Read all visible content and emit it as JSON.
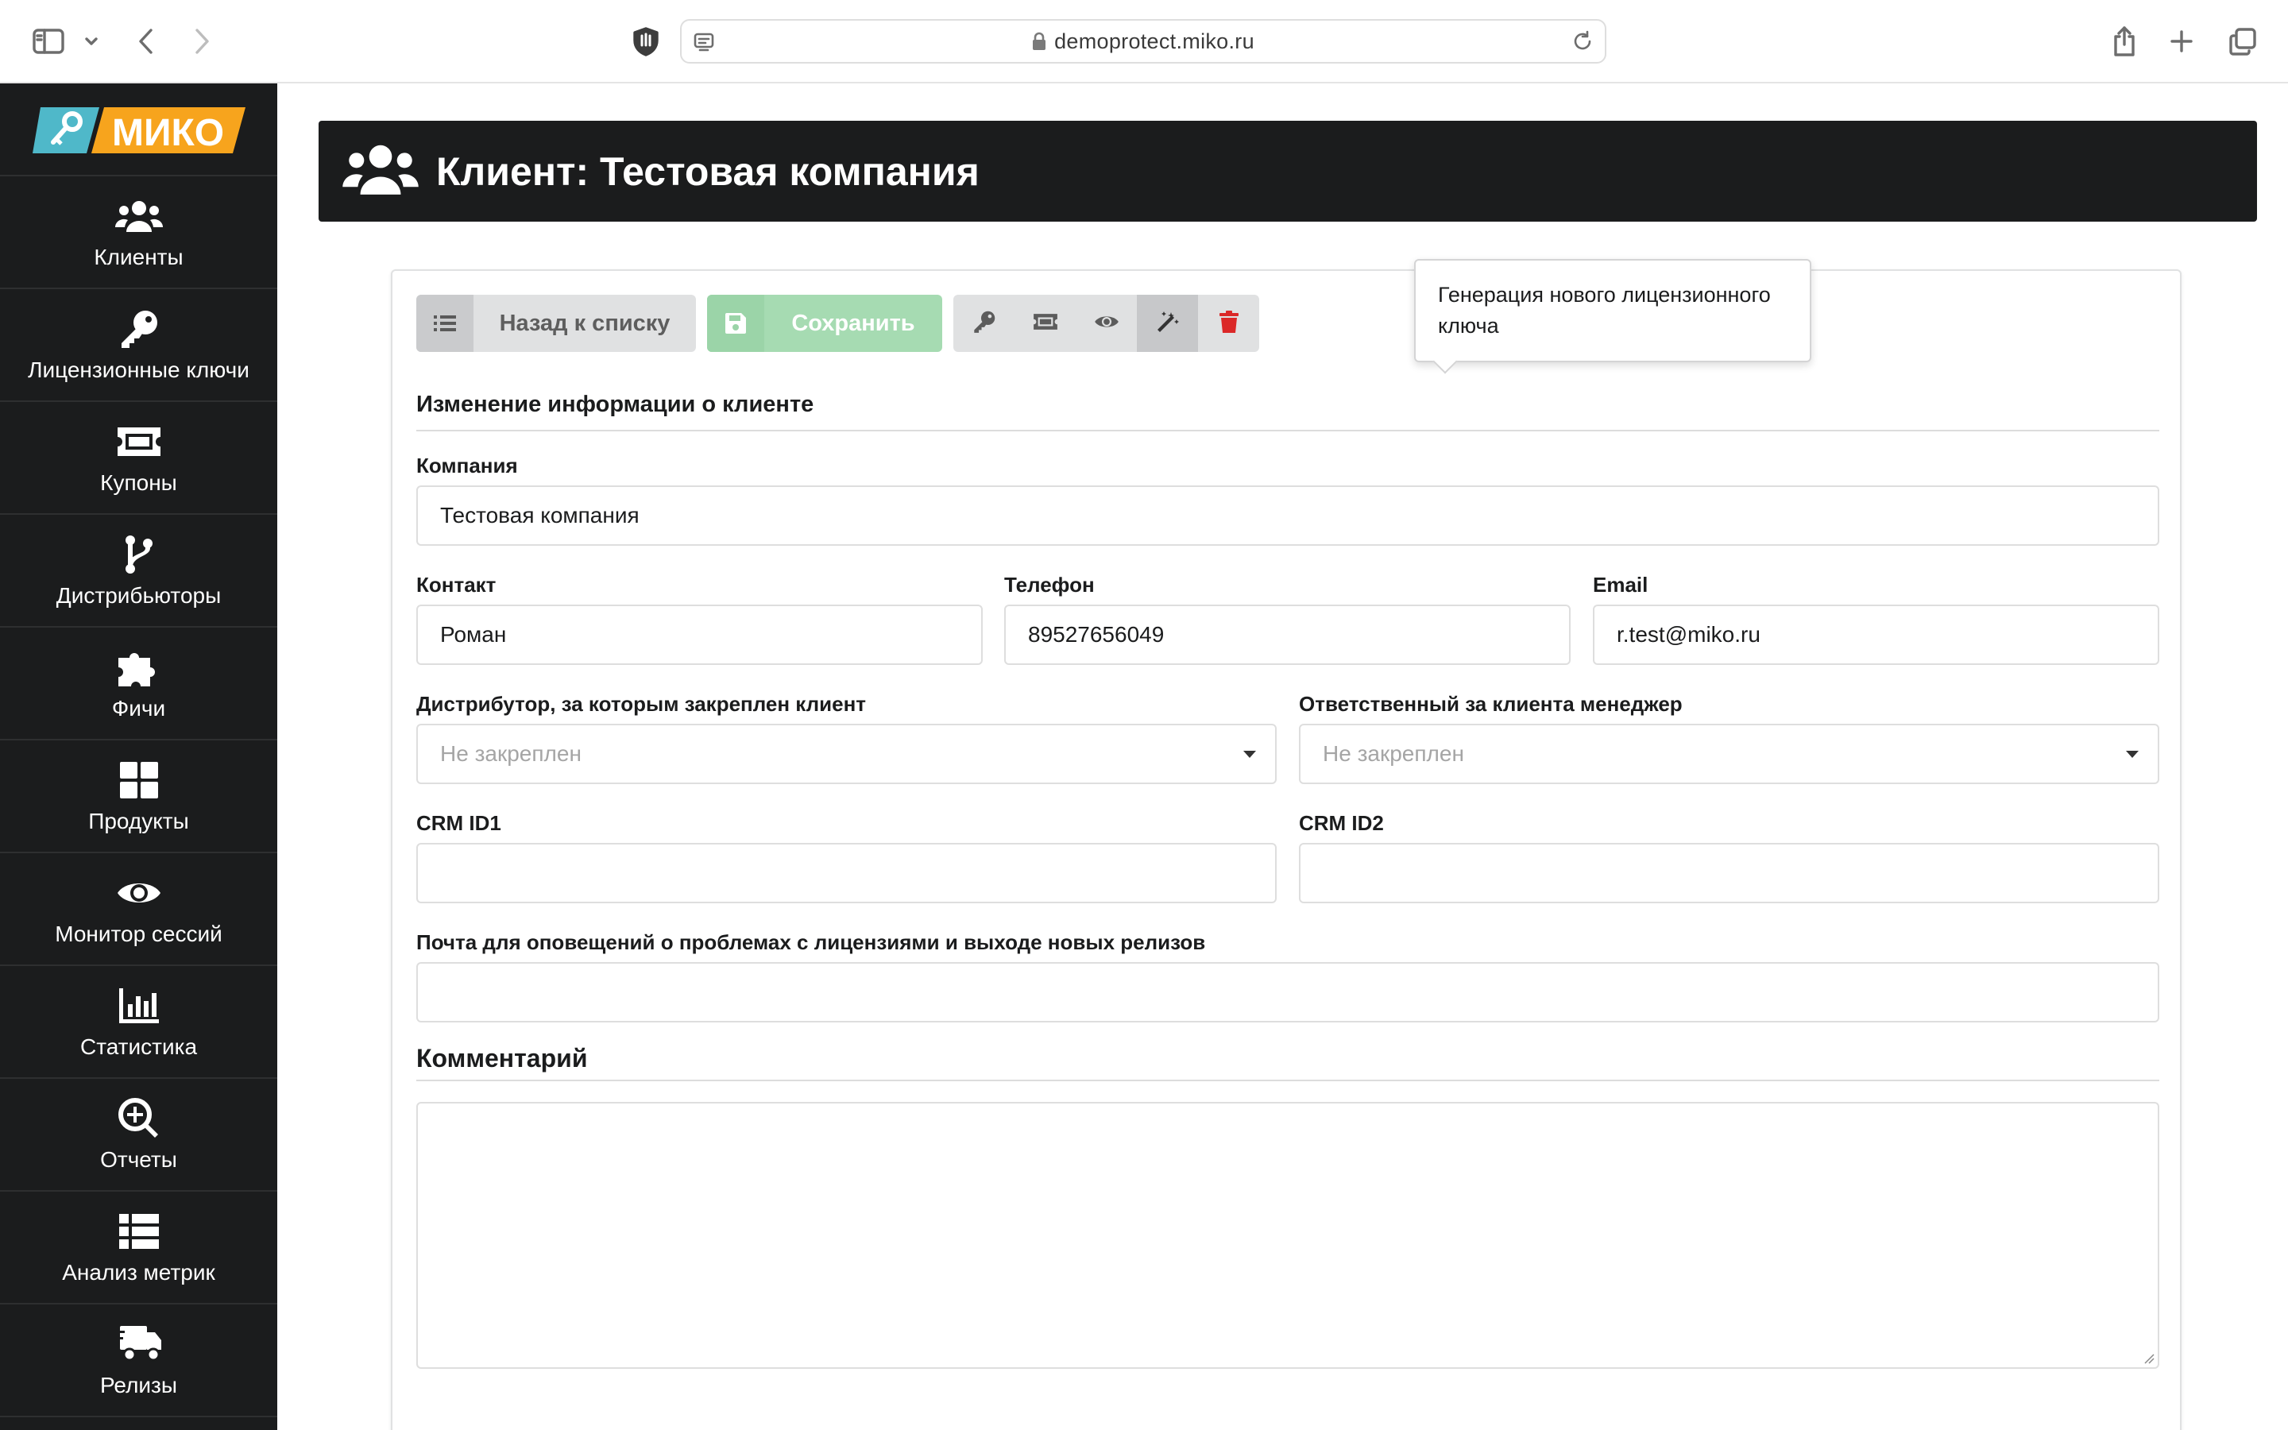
{
  "browser": {
    "url": "demoprotect.miko.ru"
  },
  "brand": {
    "logo_text": "МИКО",
    "accent_orange": "#f7a41d",
    "accent_teal": "#4fb8c9"
  },
  "sidebar": {
    "items": [
      {
        "label": "Клиенты",
        "icon": "users-icon"
      },
      {
        "label": "Лицензионные ключи",
        "icon": "key-icon"
      },
      {
        "label": "Купоны",
        "icon": "ticket-icon"
      },
      {
        "label": "Дистрибьюторы",
        "icon": "code-branch-icon"
      },
      {
        "label": "Фичи",
        "icon": "puzzle-icon"
      },
      {
        "label": "Продукты",
        "icon": "grid-icon"
      },
      {
        "label": "Монитор сессий",
        "icon": "eye-icon"
      },
      {
        "label": "Статистика",
        "icon": "bar-chart-icon"
      },
      {
        "label": "Отчеты",
        "icon": "search-plus-icon"
      },
      {
        "label": "Анализ метрик",
        "icon": "table-icon"
      },
      {
        "label": "Релизы",
        "icon": "truck-icon"
      }
    ]
  },
  "header": {
    "title": "Клиент: Тестовая компания"
  },
  "toolbar": {
    "back_label": "Назад к списку",
    "save_label": "Сохранить",
    "save_color": "#a6dbb2",
    "delete_color": "#db2828"
  },
  "tooltip": {
    "text": "Генерация нового лицензионного ключа"
  },
  "form": {
    "section_title": "Изменение информации о клиенте",
    "company": {
      "label": "Компания",
      "value": "Тестовая компания"
    },
    "contact": {
      "label": "Контакт",
      "value": "Роман"
    },
    "phone": {
      "label": "Телефон",
      "value": "89527656049"
    },
    "email": {
      "label": "Email",
      "value": "r.test@miko.ru"
    },
    "distributor": {
      "label": "Дистрибутор, за которым закреплен клиент",
      "value": "Не закреплен"
    },
    "manager": {
      "label": "Ответственный за клиента менеджер",
      "value": "Не закреплен"
    },
    "crm1": {
      "label": "CRM ID1",
      "value": ""
    },
    "crm2": {
      "label": "CRM ID2",
      "value": ""
    },
    "notify_email": {
      "label": "Почта для оповещений о проблемах с лицензиями и выходе новых релизов",
      "value": ""
    },
    "comment": {
      "label": "Комментарий",
      "value": ""
    }
  }
}
